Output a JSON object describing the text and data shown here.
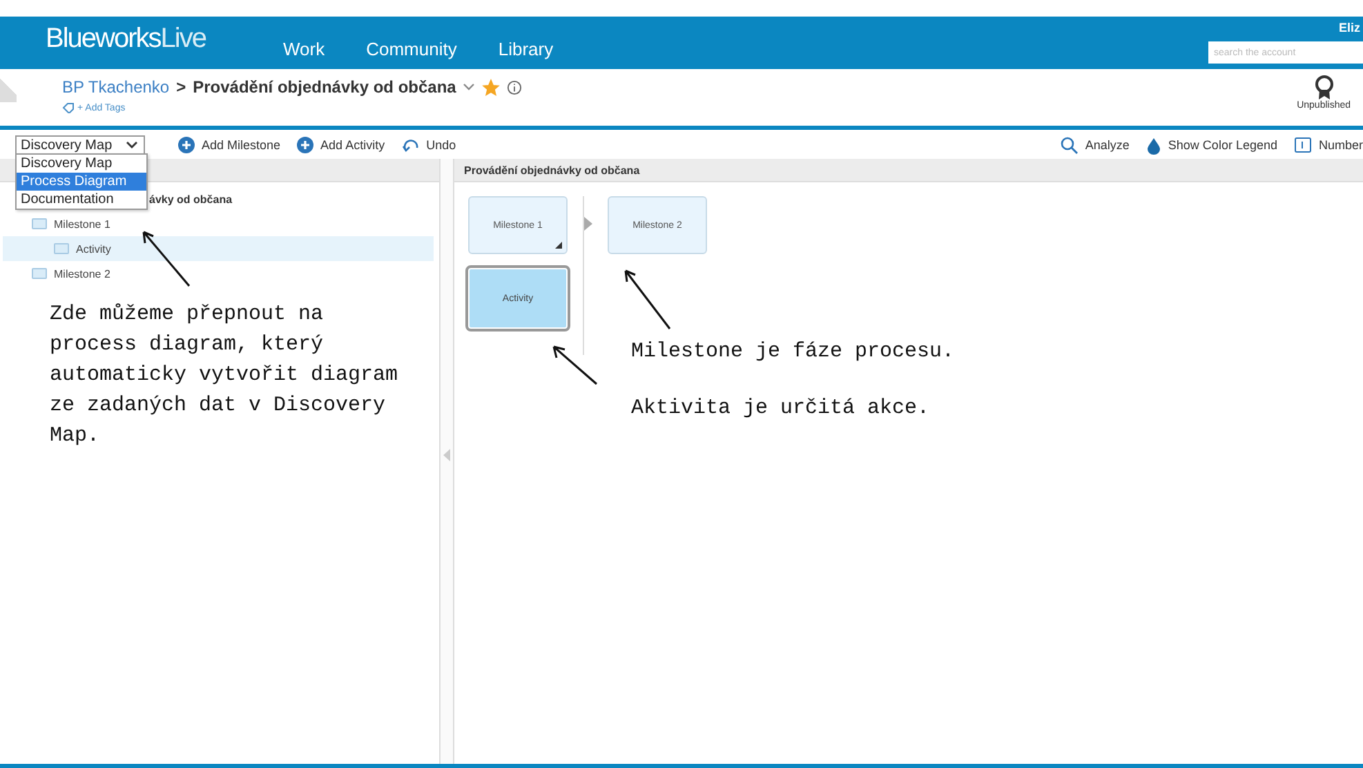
{
  "header": {
    "logo_bold": "Blueworks",
    "logo_light": "Live",
    "nav": [
      {
        "label": "Work"
      },
      {
        "label": "Community"
      },
      {
        "label": "Library"
      }
    ],
    "user": "Eliz",
    "search": {
      "placeholder": "search the account"
    }
  },
  "breadcrumb": {
    "parent": "BP Tkachenko",
    "separator": ">",
    "title": "Provádění objednávky od občana",
    "starred": true,
    "tags_link": "+ Add Tags",
    "status": "Unpublished"
  },
  "toolbar": {
    "view_select": "Discovery Map",
    "view_options": [
      {
        "label": "Discovery Map",
        "selected": false
      },
      {
        "label": "Process Diagram",
        "selected": true
      },
      {
        "label": "Documentation",
        "selected": false
      }
    ],
    "left_actions": [
      {
        "label": "Add Milestone",
        "kind": "add"
      },
      {
        "label": "Add Activity",
        "kind": "add"
      },
      {
        "label": "Undo",
        "kind": "undo"
      }
    ],
    "right_actions": [
      {
        "label": "Analyze",
        "kind": "search"
      },
      {
        "label": "Show Color Legend",
        "kind": "drop"
      },
      {
        "label": "Number",
        "kind": "number"
      }
    ]
  },
  "tree": {
    "root_label": "ávky od občana",
    "items": [
      {
        "label": "Milestone 1",
        "selected": false,
        "children": [
          {
            "label": "Activity",
            "selected": true
          }
        ]
      },
      {
        "label": "Milestone 2",
        "selected": false
      }
    ]
  },
  "diagram": {
    "title": "Provádění objednávky od občana",
    "milestones": [
      {
        "label": "Milestone 1",
        "expandable": true,
        "activities": [
          {
            "label": "Activity",
            "selected": true
          }
        ]
      },
      {
        "label": "Milestone 2",
        "expandable": false
      }
    ]
  },
  "annotations": [
    {
      "text": "Zde můžeme přepnout na process diagram, který automaticky vytvořit diagram ze zadaných dat v Discovery Map."
    },
    {
      "text": "Milestone je fáze procesu."
    },
    {
      "text": "Aktivita je určitá akce."
    }
  ]
}
